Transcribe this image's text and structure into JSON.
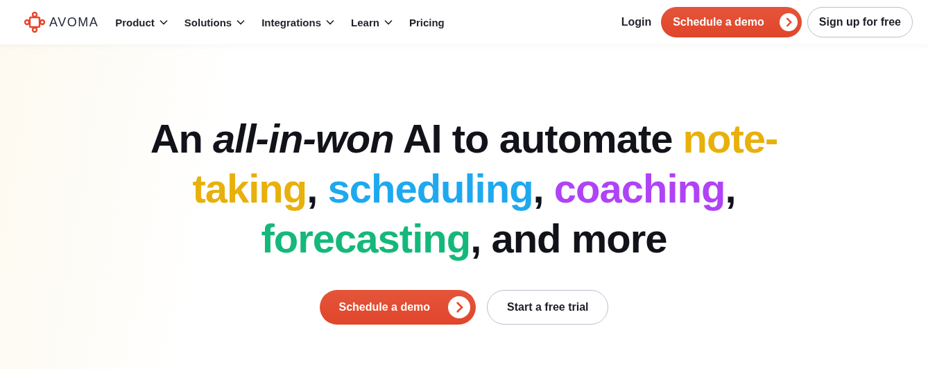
{
  "logo": {
    "text": "AVOMA"
  },
  "nav": [
    {
      "label": "Product",
      "dropdown": true
    },
    {
      "label": "Solutions",
      "dropdown": true
    },
    {
      "label": "Integrations",
      "dropdown": true
    },
    {
      "label": "Learn",
      "dropdown": true
    },
    {
      "label": "Pricing",
      "dropdown": false
    }
  ],
  "header_actions": {
    "login": "Login",
    "demo": "Schedule a demo",
    "signup": "Sign up for free"
  },
  "headline": [
    [
      {
        "text": "An ",
        "color": "#12131a",
        "italic": false
      },
      {
        "text": "all-in-won",
        "color": "#12131a",
        "italic": true
      },
      {
        "text": " AI to automate ",
        "color": "#12131a",
        "italic": false
      },
      {
        "text": "note-",
        "color": "#e8b00c",
        "italic": false
      }
    ],
    [
      {
        "text": "taking",
        "color": "#e8b00c",
        "italic": false
      },
      {
        "text": ", ",
        "color": "#12131a",
        "italic": false
      },
      {
        "text": "scheduling",
        "color": "#1ea9ef",
        "italic": false
      },
      {
        "text": ", ",
        "color": "#12131a",
        "italic": false
      },
      {
        "text": "coaching",
        "color": "#b043f5",
        "italic": false
      },
      {
        "text": ",",
        "color": "#12131a",
        "italic": false
      }
    ],
    [
      {
        "text": "forecasting",
        "color": "#14b87a",
        "italic": false
      },
      {
        "text": ", and more",
        "color": "#12131a",
        "italic": false
      }
    ]
  ],
  "cta": {
    "demo": "Schedule a demo",
    "trial": "Start a free trial"
  }
}
